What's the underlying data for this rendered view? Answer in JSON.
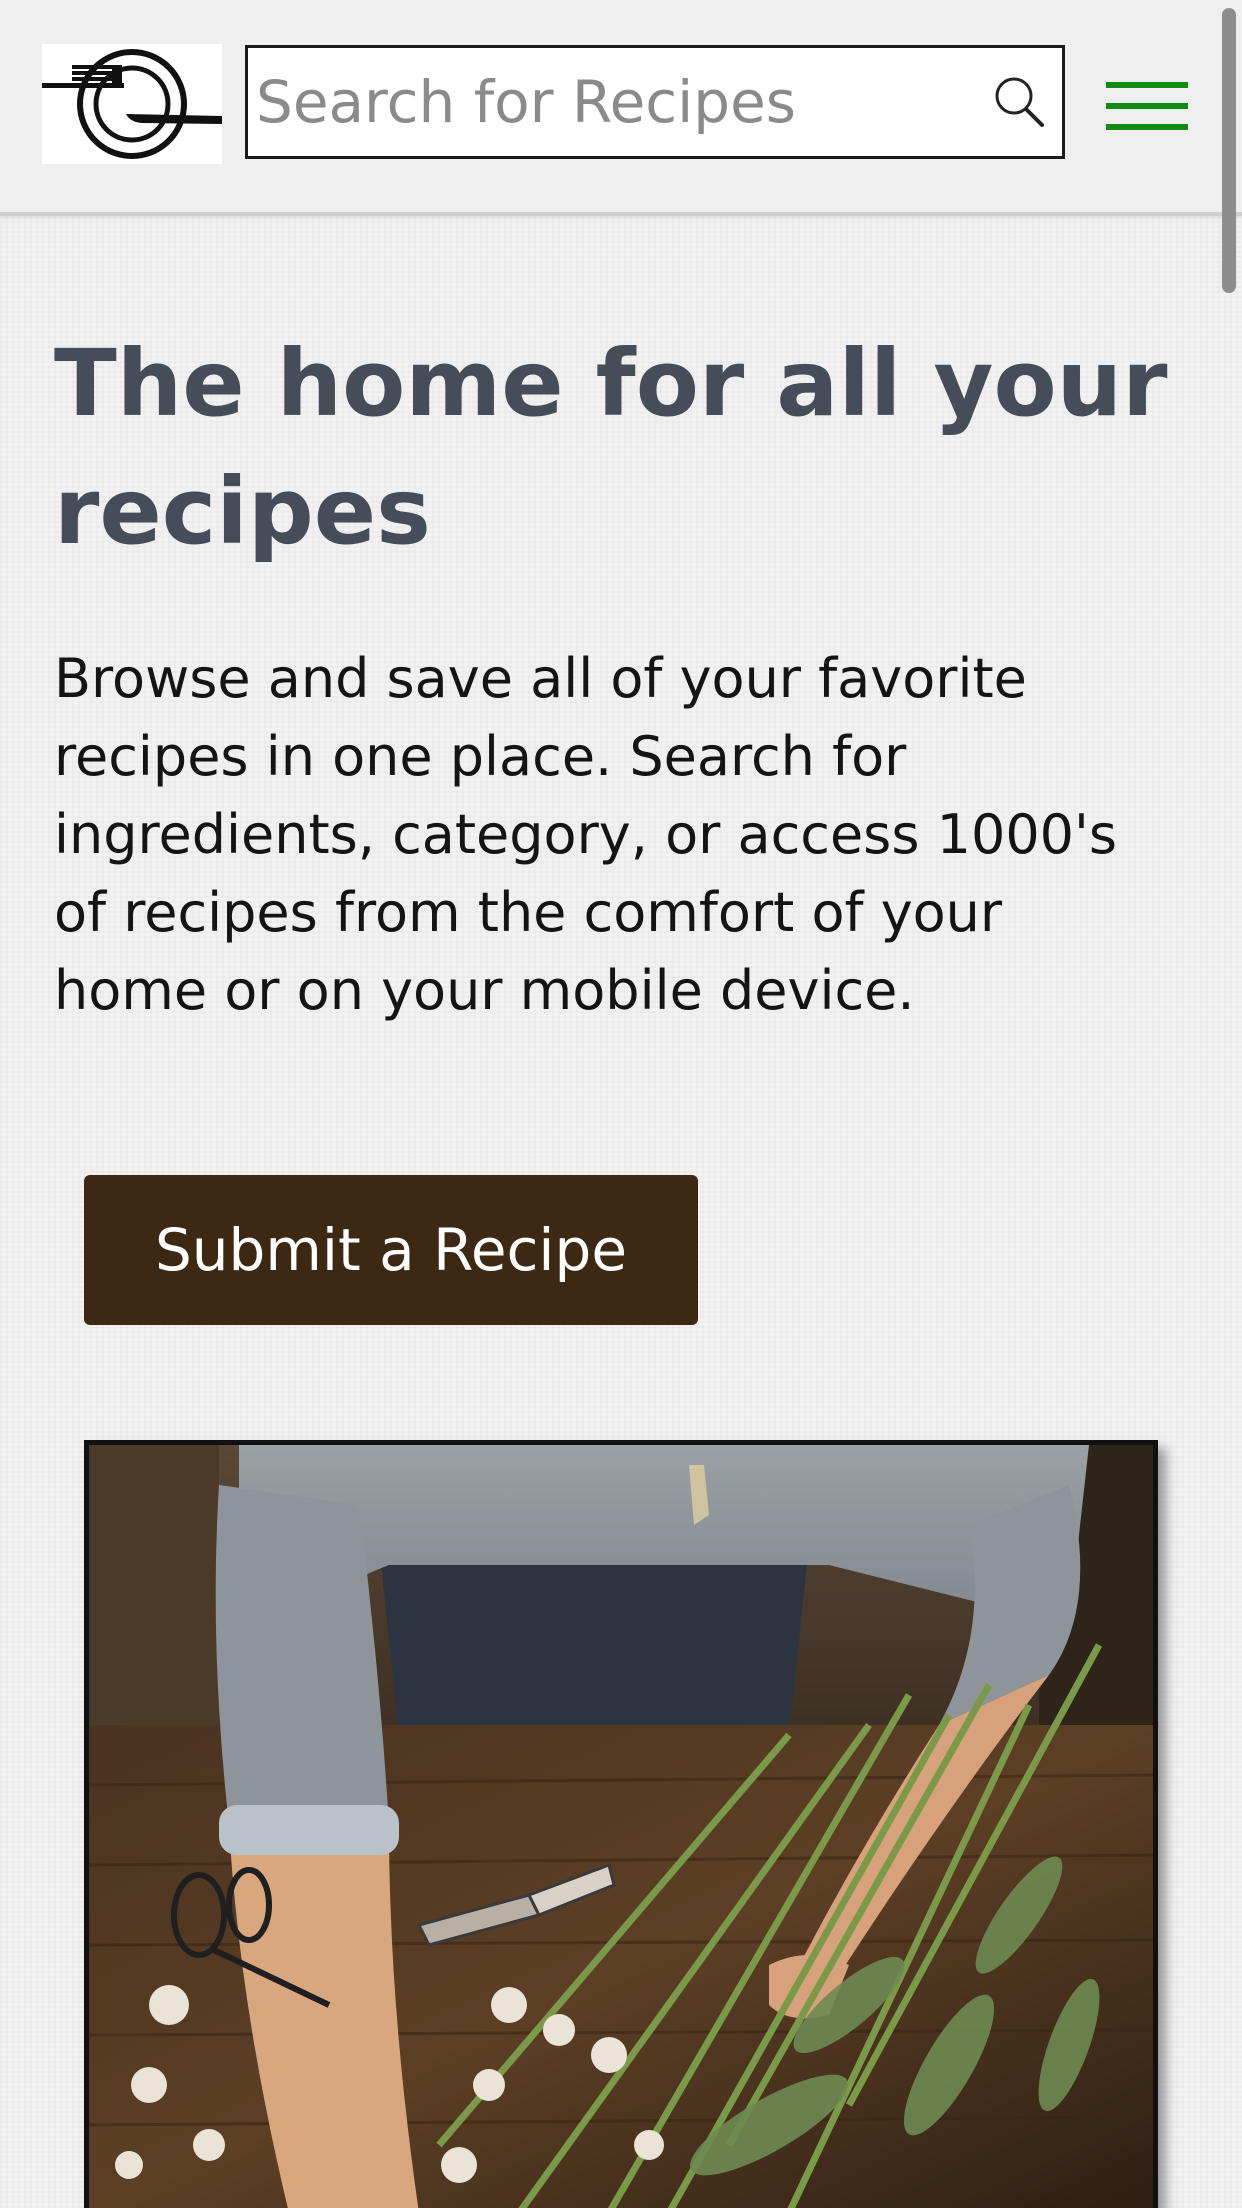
{
  "header": {
    "logo_icon": "plate-fork-knife-logo",
    "search": {
      "placeholder": "Search for Recipes",
      "value": "",
      "icon": "search-icon"
    },
    "menu_icon": "hamburger-menu-icon",
    "menu_color": "#138a13"
  },
  "main": {
    "title": "The home for all your recipes",
    "description": "Browse and save all of your favorite recipes in one place. Search for ingredients, category, or access 1000's of recipes from the comfort of your home or on your mobile device.",
    "submit_button_label": "Submit a Recipe",
    "submit_button_color": "#3d2814",
    "hero_image_icon": "person-arranging-flowers-photo"
  },
  "colors": {
    "title": "#444d58",
    "text": "#141414",
    "background": "#f2f2f2"
  }
}
